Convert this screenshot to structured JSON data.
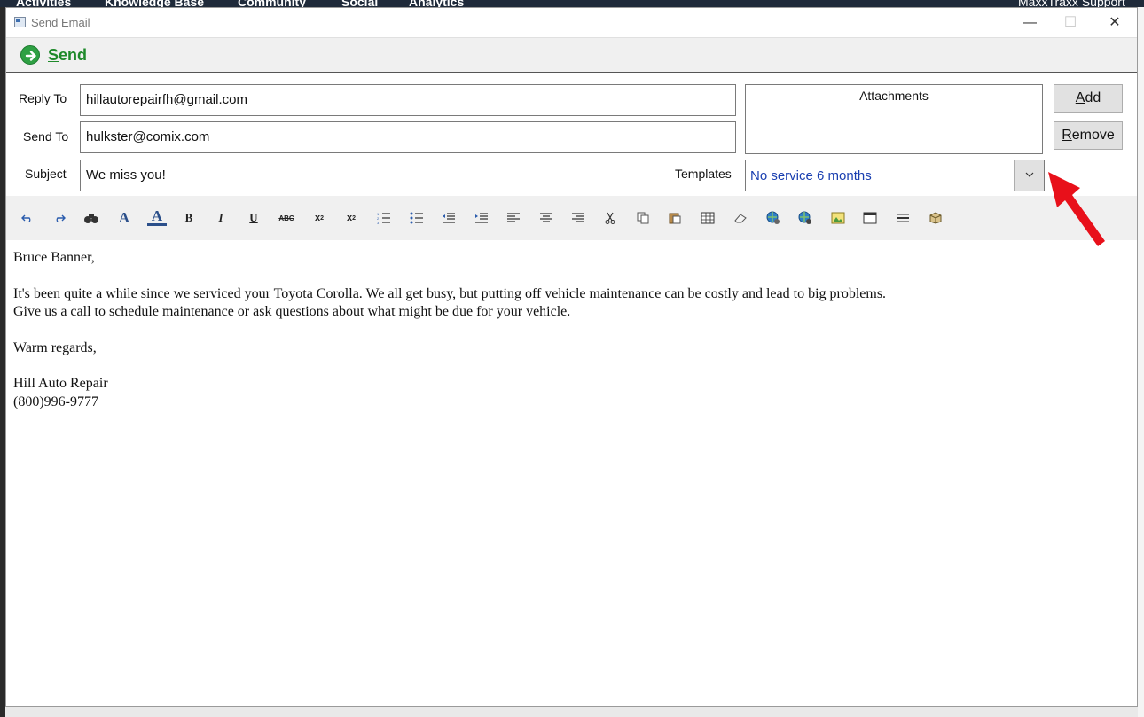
{
  "background_app": {
    "tabs": [
      "Activities",
      "Knowledge Base",
      "Community",
      "Social",
      "Analytics"
    ],
    "account": "MaxxTraxx Support"
  },
  "window": {
    "title": "Send Email",
    "minimize": "—",
    "maximize": "☐",
    "close": "✕"
  },
  "toolbar_send": {
    "label": "Send"
  },
  "form": {
    "reply_to_label": "Reply To",
    "reply_to_value": "hillautorepairfh@gmail.com",
    "send_to_label": "Send To",
    "send_to_value": "hulkster@comix.com",
    "subject_label": "Subject",
    "subject_value": "We miss you!",
    "templates_label": "Templates",
    "templates_value": "No service 6 months"
  },
  "attachments": {
    "title": "Attachments",
    "add_label": "Add",
    "remove_label": "Remove"
  },
  "editor_toolbar": [
    "undo-icon",
    "redo-icon",
    "find-icon",
    "font-color-icon",
    "highlight-icon",
    "bold-icon",
    "italic-icon",
    "underline-icon",
    "strikethrough-icon",
    "subscript-icon",
    "superscript-icon",
    "ordered-list-icon",
    "bullet-list-icon",
    "outdent-icon",
    "indent-icon",
    "align-left-icon",
    "align-center-icon",
    "align-right-icon",
    "cut-icon",
    "copy-icon",
    "paste-icon",
    "table-icon",
    "eraser-icon",
    "link-icon",
    "unlink-icon",
    "image-icon",
    "window-icon",
    "horizontal-rule-icon",
    "insert-object-icon"
  ],
  "body": {
    "greeting": "Bruce Banner,",
    "line1": "It's been quite a while since we serviced your Toyota Corolla. We all get busy, but putting off vehicle maintenance can be costly and lead to big problems.",
    "line2": "Give us a call to schedule maintenance or ask questions about what might be due for your vehicle.",
    "closing": "Warm regards,",
    "company": "Hill Auto Repair",
    "phone": "(800)996-9777"
  },
  "colors": {
    "send_green": "#1f8a2b",
    "template_text": "#1a3fb0",
    "annotation_arrow": "#e8101a"
  }
}
